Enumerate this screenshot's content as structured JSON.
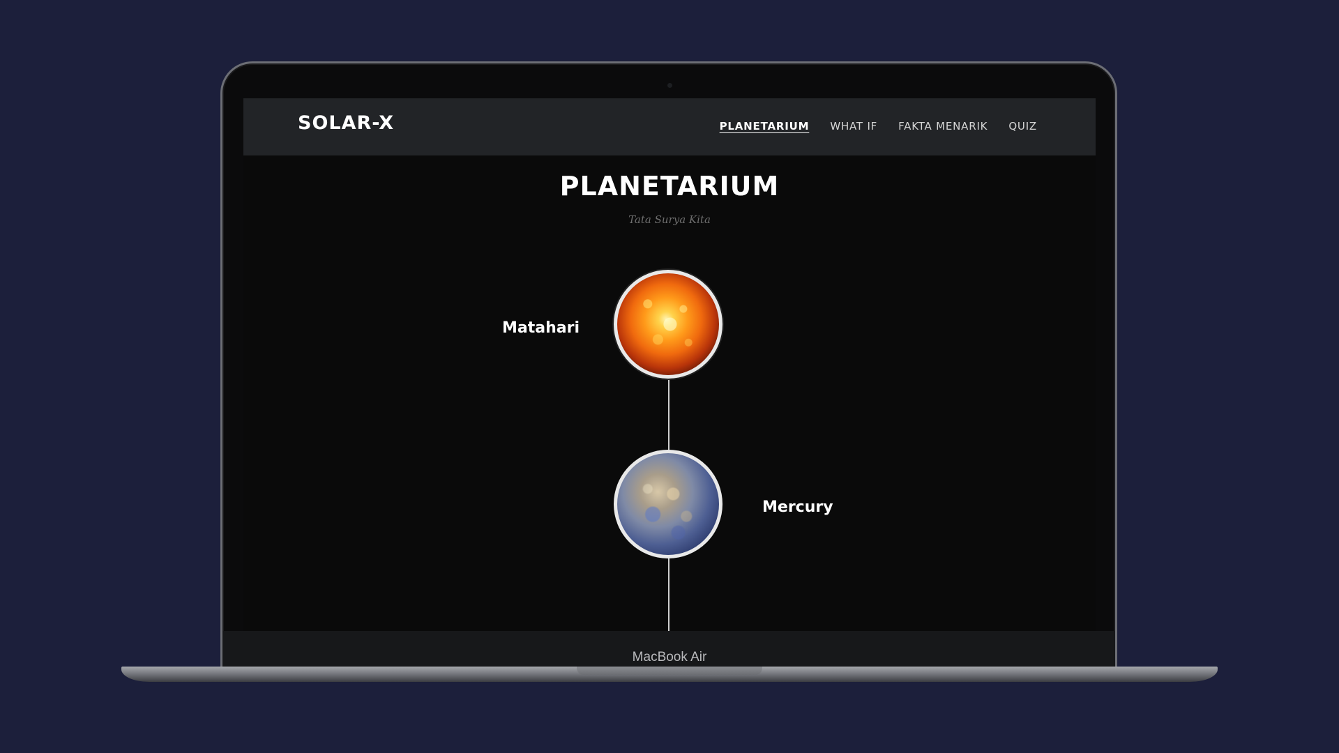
{
  "app": {
    "brand": "SOLAR-X",
    "nav": [
      {
        "label": "PLANETARIUM",
        "active": true
      },
      {
        "label": "WHAT IF",
        "active": false
      },
      {
        "label": "FAKTA MENARIK",
        "active": false
      },
      {
        "label": "QUIZ",
        "active": false
      }
    ],
    "page_title": "PLANETARIUM",
    "page_subtitle": "Tata Surya Kita",
    "planets": [
      {
        "name": "Matahari",
        "image": "sun-image"
      },
      {
        "name": "Mercury",
        "image": "mercury-image"
      }
    ]
  },
  "device": {
    "model_label": "MacBook Air"
  },
  "colors": {
    "background": "#1c1f3b",
    "navbar": "#222427",
    "screen": "#0a0a0a",
    "text": "#ffffff",
    "subtitle": "#6e6e6e"
  }
}
